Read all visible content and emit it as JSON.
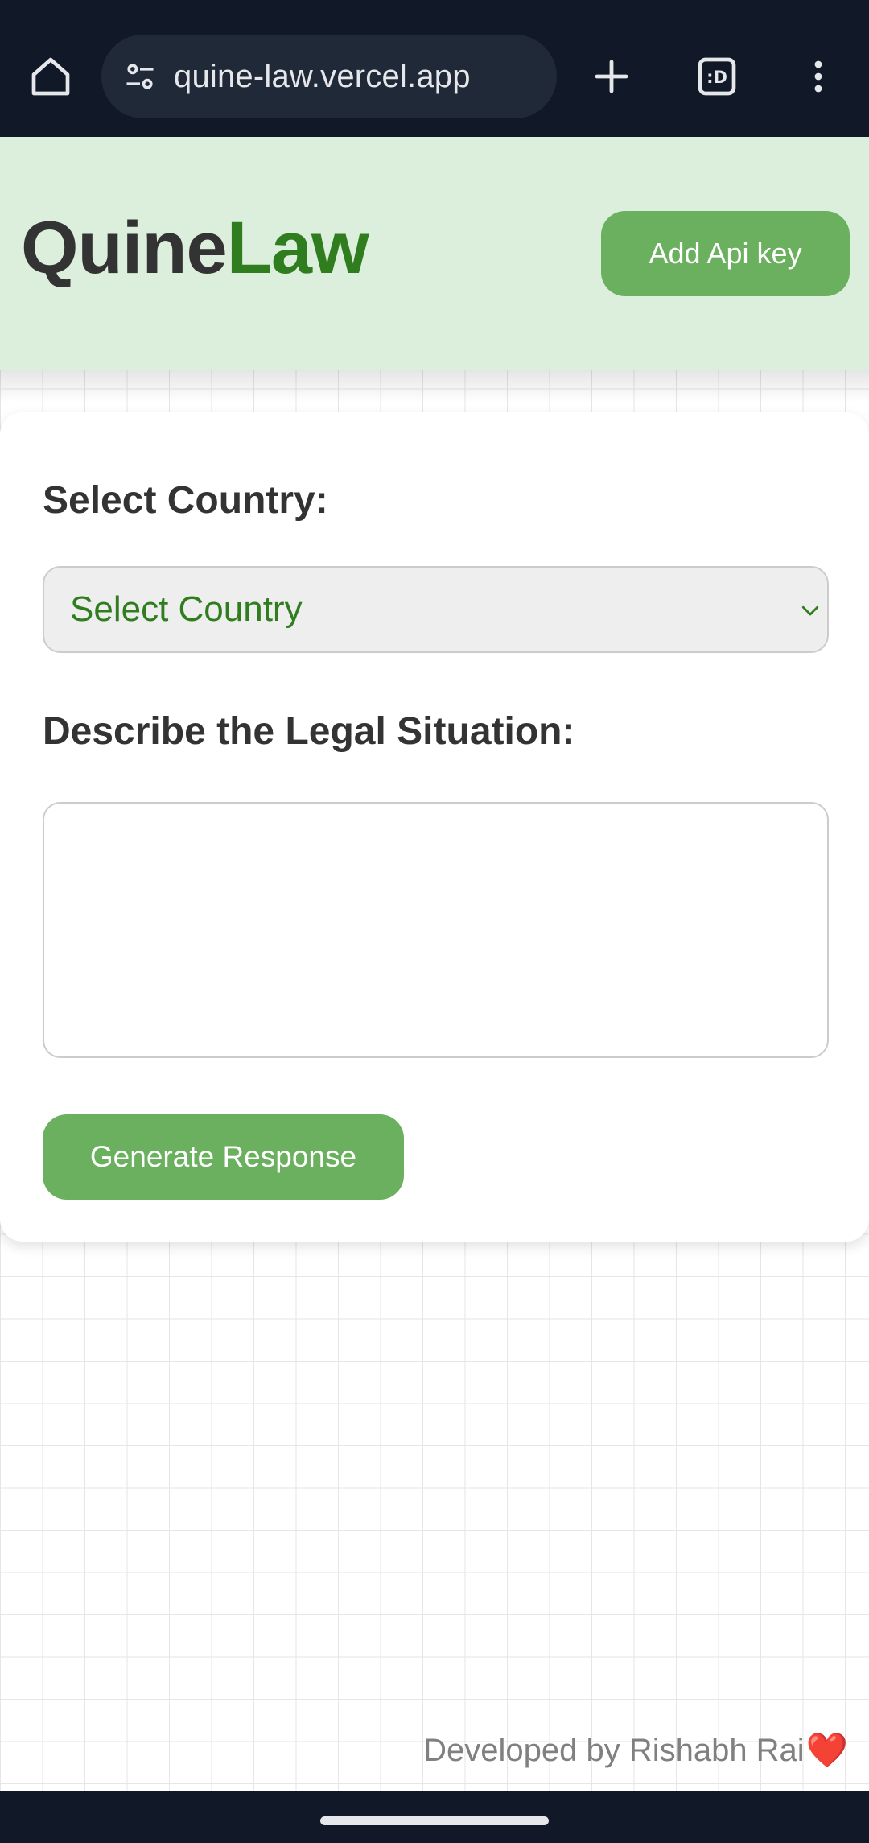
{
  "browser": {
    "url": "quine-law.vercel.app",
    "tabs_label": ":D",
    "icons": [
      "home-icon",
      "site-settings-icon",
      "new-tab-icon",
      "tab-switcher-icon",
      "more-options-icon"
    ]
  },
  "header": {
    "logo_part1": "Quine",
    "logo_part2": "Law",
    "api_button_label": "Add Api key"
  },
  "form": {
    "country_label": "Select Country:",
    "country_select_value": "Select Country",
    "situation_label": "Describe the Legal Situation:",
    "situation_value": "",
    "generate_button_label": "Generate Response"
  },
  "footer": {
    "credit_text": "Developed by Rishabh Rai",
    "heart": "❤️"
  },
  "colors": {
    "accent_green": "#6ab05e",
    "logo_green": "#2f7d1f",
    "header_bg": "#dcefdc",
    "browser_bg": "#111827"
  }
}
